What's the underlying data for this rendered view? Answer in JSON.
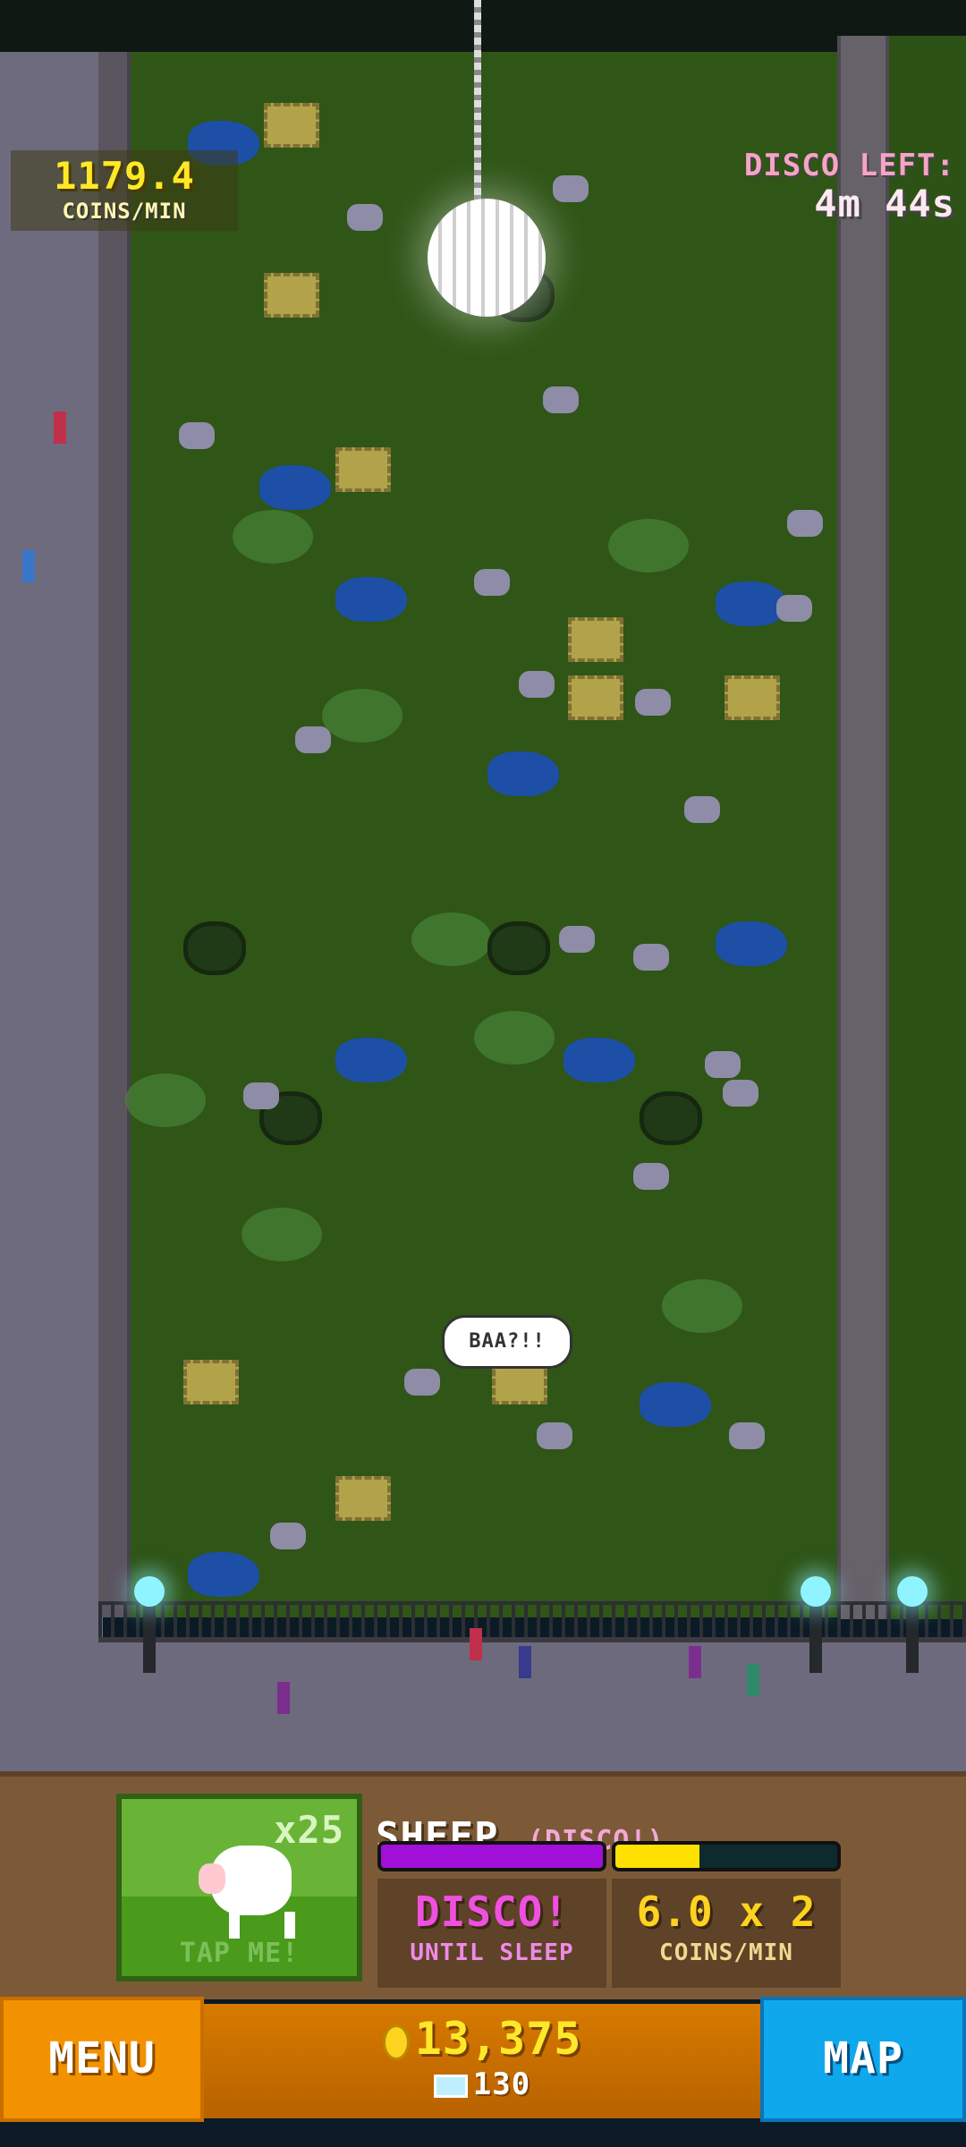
{
  "hud": {
    "coin_rate": "1179.4",
    "coin_rate_label": "COINS/MIN",
    "disco_left_label": "DISCO LEFT:",
    "disco_left_time": "4m 44s"
  },
  "scene": {
    "speech_bubble": "BAA?!!"
  },
  "animal_panel": {
    "tap_count": "x25",
    "tap_label": "TAP ME!",
    "name": "SHEEP",
    "state": "(DISCO!)",
    "disco_bar_percent": 100,
    "coin_bar_percent": 38,
    "status_value": "DISCO!",
    "status_label": "UNTIL SLEEP",
    "rate_value": "6.0 x 2",
    "rate_label": "COINS/MIN"
  },
  "footer": {
    "menu_label": "MENU",
    "coins": "13,375",
    "gems": "130",
    "map_label": "MAP"
  },
  "colors": {
    "disco_bar": "#a010d8",
    "coin_bar": "#ffe000",
    "status": "#f050e0",
    "rate": "#ffd21f"
  }
}
